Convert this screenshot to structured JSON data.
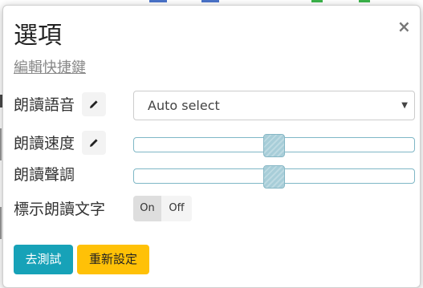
{
  "dialog": {
    "title": "選項",
    "shortcut_link": "編輯快捷鍵",
    "close_glyph": "×"
  },
  "rows": {
    "voice": {
      "label": "朗讀語音",
      "select_value": "Auto select"
    },
    "speed": {
      "label": "朗讀速度",
      "slider_value": 0.5
    },
    "pitch": {
      "label": "朗讀聲調",
      "slider_value": 0.5
    },
    "highlight": {
      "label": "標示朗讀文字",
      "on_label": "On",
      "off_label": "Off",
      "selected": "On"
    }
  },
  "buttons": {
    "test": "去測試",
    "reset": "重新設定"
  },
  "colors": {
    "test_button": "#17a2b8",
    "reset_button": "#ffc107",
    "slider_thumb": "#a7cdd8",
    "slider_border": "#7fb7c6"
  },
  "icons": {
    "edit": "pencil-icon",
    "close": "close-icon",
    "caret": "caret-down-icon"
  }
}
